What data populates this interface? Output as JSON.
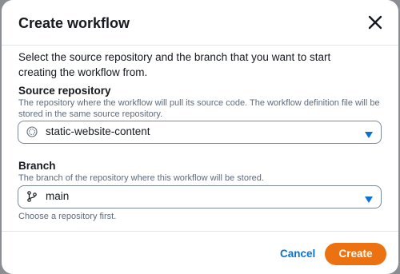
{
  "dialog": {
    "title": "Create workflow",
    "description": "Select the source repository and the branch that you want to start creating the workflow from."
  },
  "source_repository": {
    "label": "Source repository",
    "hint": "The repository where the workflow will pull its source code. The workflow definition file will be stored in the same source repository.",
    "selected_value": "static-website-content",
    "icon": "repository-icon"
  },
  "branch": {
    "label": "Branch",
    "hint": "The branch of the repository where this workflow will be stored.",
    "selected_value": "main",
    "icon": "git-branch-icon",
    "constraint_text": "Choose a repository first."
  },
  "footer": {
    "cancel_label": "Cancel",
    "create_label": "Create"
  },
  "colors": {
    "primary_button": "#ec7211",
    "link": "#0972d3",
    "text": "#16191f",
    "secondary_text": "#5f6b7a",
    "dropdown_caret": "#0972d3"
  }
}
